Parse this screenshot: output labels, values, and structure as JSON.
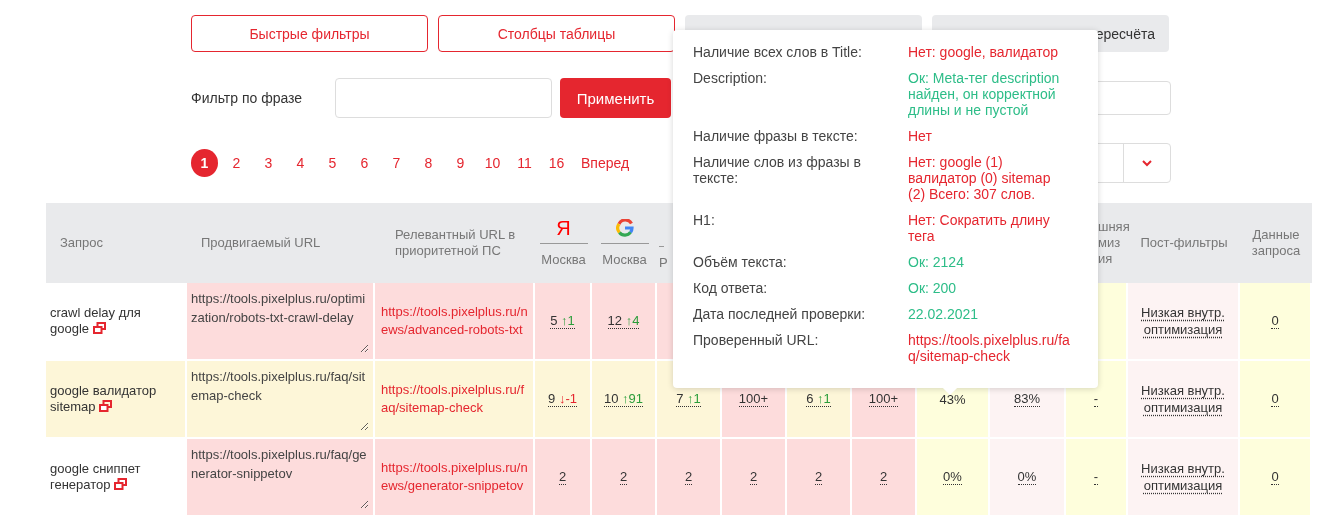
{
  "top_buttons": [
    {
      "kind": "outline",
      "label": "Быстрые фильтры"
    },
    {
      "kind": "outline",
      "label": "Столбцы таблицы"
    },
    {
      "kind": "muted"
    },
    {
      "kind": "muted",
      "label": "ересчёта"
    }
  ],
  "phrase_filter": {
    "label": "Фильтр по фразе",
    "apply": "Применить"
  },
  "pagination": [
    {
      "label": "1",
      "selected": true
    },
    {
      "label": "2",
      "selected": false
    },
    {
      "label": "3",
      "selected": false
    },
    {
      "label": "4",
      "selected": false
    },
    {
      "label": "5",
      "selected": false
    },
    {
      "label": "6",
      "selected": false
    },
    {
      "label": "7",
      "selected": false
    },
    {
      "label": "8",
      "selected": false
    },
    {
      "label": "9",
      "selected": false
    },
    {
      "label": "10",
      "selected": false
    },
    {
      "label": "11",
      "selected": false
    },
    {
      "label": "16",
      "selected": false
    }
  ],
  "next_page": "Вперед",
  "table": {
    "columns": [
      {
        "kind": "text",
        "label": "Запрос"
      },
      {
        "kind": "text",
        "label": "Продвигаемый URL"
      },
      {
        "kind": "text",
        "label": "Релевантный URL в приоритетной ПС"
      },
      {
        "kind": "letter_logo",
        "logo": "Я",
        "region": "Москва"
      },
      {
        "kind": "ring_logo",
        "region": "Москва"
      },
      {
        "kind": "partial",
        "label": "Р"
      },
      {
        "kind": "blank"
      },
      {
        "kind": "blank"
      },
      {
        "kind": "blank"
      },
      {
        "kind": "blank"
      },
      {
        "kind": "blank"
      },
      {
        "kind": "tail",
        "label": "шняя\nмиз\nия"
      },
      {
        "kind": "centered",
        "label": "Пост-фильтры"
      },
      {
        "kind": "centered",
        "label": "Данные запроса"
      }
    ],
    "rows": [
      {
        "cells": [
          {
            "kind": "query",
            "text": "crawl delay для google",
            "color": "#ffffff"
          },
          {
            "kind": "field",
            "value": "https://tools.pixelplus.ru/optimization/robots-txt-crawl-delay",
            "color": "#fddcdc"
          },
          {
            "kind": "link",
            "text": "https://tools.pixelplus.ru/news/advanced-robots-txt",
            "color": "#fddcdc"
          },
          {
            "kind": "pos",
            "value": "5",
            "change": "↑1",
            "rising": true,
            "color": "#fddcdc"
          },
          {
            "kind": "pos",
            "value": "12",
            "change": "↑4",
            "rising": true,
            "color": "#fddcdc"
          },
          {
            "kind": "empty",
            "color": "#fddcdc"
          },
          {
            "kind": "empty"
          },
          {
            "kind": "empty"
          },
          {
            "kind": "empty"
          },
          {
            "kind": "empty"
          },
          {
            "kind": "empty"
          },
          {
            "kind": "empty",
            "color": "#fefedc"
          },
          {
            "kind": "filter",
            "text": "Низкая внутр. оптимизация",
            "color": "#fdf3f3"
          },
          {
            "kind": "num",
            "value": "0",
            "color": "#fefedc"
          }
        ]
      },
      {
        "cells": [
          {
            "kind": "query",
            "text": "google валидатор sitemap",
            "color": "#fdf6d8"
          },
          {
            "kind": "field",
            "value": "https://tools.pixelplus.ru/faq/sitemap-check",
            "color": "#fdf6d8"
          },
          {
            "kind": "link",
            "text": "https://tools.pixelplus.ru/faq/sitemap-check",
            "color": "#fdf6d8"
          },
          {
            "kind": "pos",
            "value": "9",
            "change": "↓-1",
            "rising": false,
            "color": "#fdf6d8"
          },
          {
            "kind": "pos",
            "value": "10",
            "change": "↑91",
            "rising": true,
            "color": "#fdf6d8"
          },
          {
            "kind": "pos",
            "value": "7",
            "change": "↑1",
            "rising": true,
            "color": "#fdf6d8"
          },
          {
            "kind": "num",
            "value": "100+",
            "color": "#fddcdc"
          },
          {
            "kind": "pos",
            "value": "6",
            "change": "↑1",
            "rising": true,
            "color": "#fdf6d8"
          },
          {
            "kind": "num",
            "value": "100+",
            "color": "#fddcdc"
          },
          {
            "kind": "plain",
            "value": "43%",
            "color": "#fefedc"
          },
          {
            "kind": "num",
            "value": "83%",
            "color": "#fdf3f3"
          },
          {
            "kind": "num",
            "value": "-",
            "color": "#fefedc"
          },
          {
            "kind": "filter",
            "text": "Низкая внутр. оптимизация",
            "color": "#fdf3f3"
          },
          {
            "kind": "num",
            "value": "0",
            "color": "#fefedc"
          }
        ]
      },
      {
        "cells": [
          {
            "kind": "query",
            "text": "google сниппет генератор",
            "color": "#ffffff"
          },
          {
            "kind": "field",
            "value": "https://tools.pixelplus.ru/faq/generator-snippetov",
            "color": "#fddcdc"
          },
          {
            "kind": "link",
            "text": "https://tools.pixelplus.ru/news/generator-snippetov",
            "color": "#fddcdc"
          },
          {
            "kind": "num",
            "value": "2",
            "color": "#fddcdc"
          },
          {
            "kind": "num",
            "value": "2",
            "color": "#fddcdc"
          },
          {
            "kind": "num",
            "value": "2",
            "color": "#fddcdc"
          },
          {
            "kind": "num",
            "value": "2",
            "color": "#fddcdc"
          },
          {
            "kind": "num",
            "value": "2",
            "color": "#fddcdc"
          },
          {
            "kind": "num",
            "value": "2",
            "color": "#fddcdc"
          },
          {
            "kind": "num",
            "value": "0%",
            "color": "#fefedc"
          },
          {
            "kind": "num",
            "value": "0%",
            "color": "#fdf3f3"
          },
          {
            "kind": "num",
            "value": "-",
            "color": "#fefedc"
          },
          {
            "kind": "filter",
            "text": "Низкая внутр. оптимизация",
            "color": "#fdf3f3"
          },
          {
            "kind": "num",
            "value": "0",
            "color": "#fefedc"
          }
        ]
      }
    ]
  },
  "popover": {
    "rows": [
      {
        "label": "Наличие всех слов в Title:",
        "value": "Нет: google, валидатор",
        "ok": false
      },
      {
        "label": "Description:",
        "value": "Ок: Meta-тег description найден, он корректной длины и не пустой",
        "ok": true
      },
      {
        "label": "Наличие фразы в тексте:",
        "value": "Нет",
        "ok": false
      },
      {
        "label": "Наличие слов из фразы в тексте:",
        "value": "Нет: google (1) валидатор (0) sitemap (2) Всего: 307 слов.",
        "ok": false
      },
      {
        "label": "H1:",
        "value": "Нет: Сократить длину тега",
        "ok": false
      },
      {
        "label": "Объём текста:",
        "value": "Ок: 2124",
        "ok": true
      },
      {
        "label": "Код ответа:",
        "value": "Ок: 200",
        "ok": true
      },
      {
        "label": "Дата последней проверки:",
        "value": "22.02.2021",
        "ok": true
      },
      {
        "label": "Проверенный URL:",
        "value": "https://tools.pixelplus.ru/faq/sitemap-check",
        "ok": false
      }
    ]
  }
}
